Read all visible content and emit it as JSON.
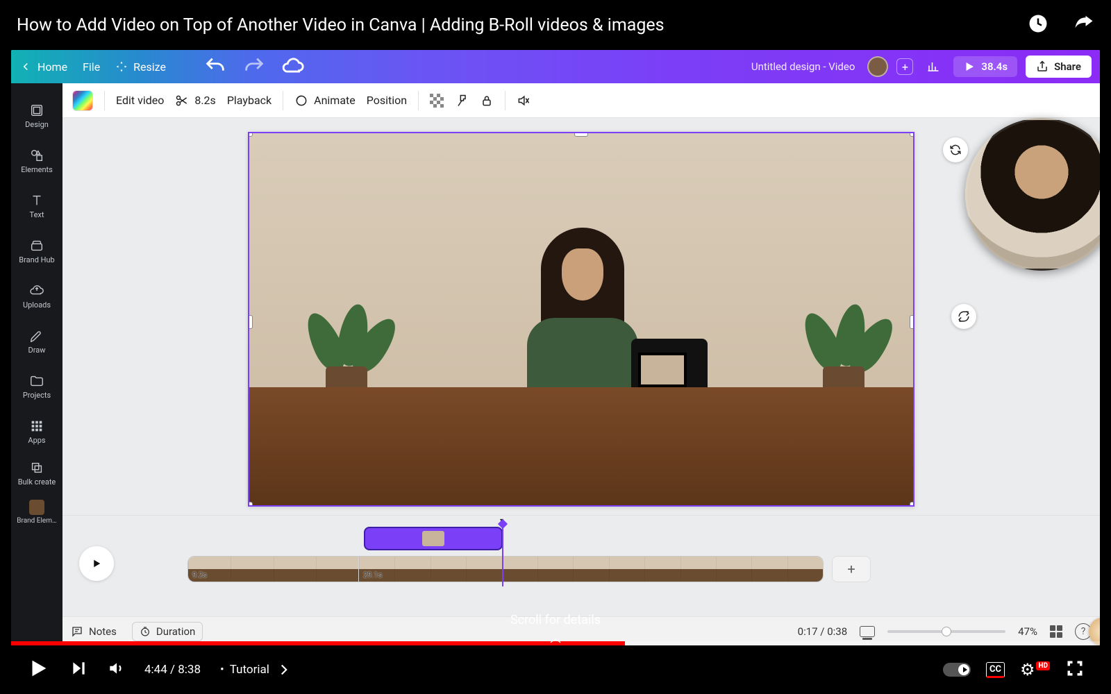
{
  "youtube": {
    "title": "How to Add Video on Top of Another Video in Canva | Adding B-Roll videos & images",
    "current_time": "4:44",
    "duration": "8:38",
    "chapter": "Tutorial",
    "scroll_hint": "Scroll for details",
    "progress_pct": 56.4
  },
  "canva": {
    "header": {
      "home": "Home",
      "file": "File",
      "resize": "Resize",
      "doc_title": "Untitled design - Video",
      "play_time": "38.4s",
      "share": "Share"
    },
    "sidebar": {
      "items": [
        {
          "label": "Design"
        },
        {
          "label": "Elements"
        },
        {
          "label": "Text"
        },
        {
          "label": "Brand Hub"
        },
        {
          "label": "Uploads"
        },
        {
          "label": "Draw"
        },
        {
          "label": "Projects"
        },
        {
          "label": "Apps"
        },
        {
          "label": "Bulk create"
        },
        {
          "label": "Brand Elem…"
        }
      ]
    },
    "toolbar": {
      "edit_video": "Edit video",
      "clip_time": "8.2s",
      "playback": "Playback",
      "animate": "Animate",
      "position": "Position"
    },
    "timeline": {
      "clip1_dur": "9.2s",
      "clip2_dur": "29.1s",
      "notes": "Notes",
      "duration_label": "Duration",
      "time_display": "0:17 / 0:38",
      "zoom": "47%"
    }
  }
}
